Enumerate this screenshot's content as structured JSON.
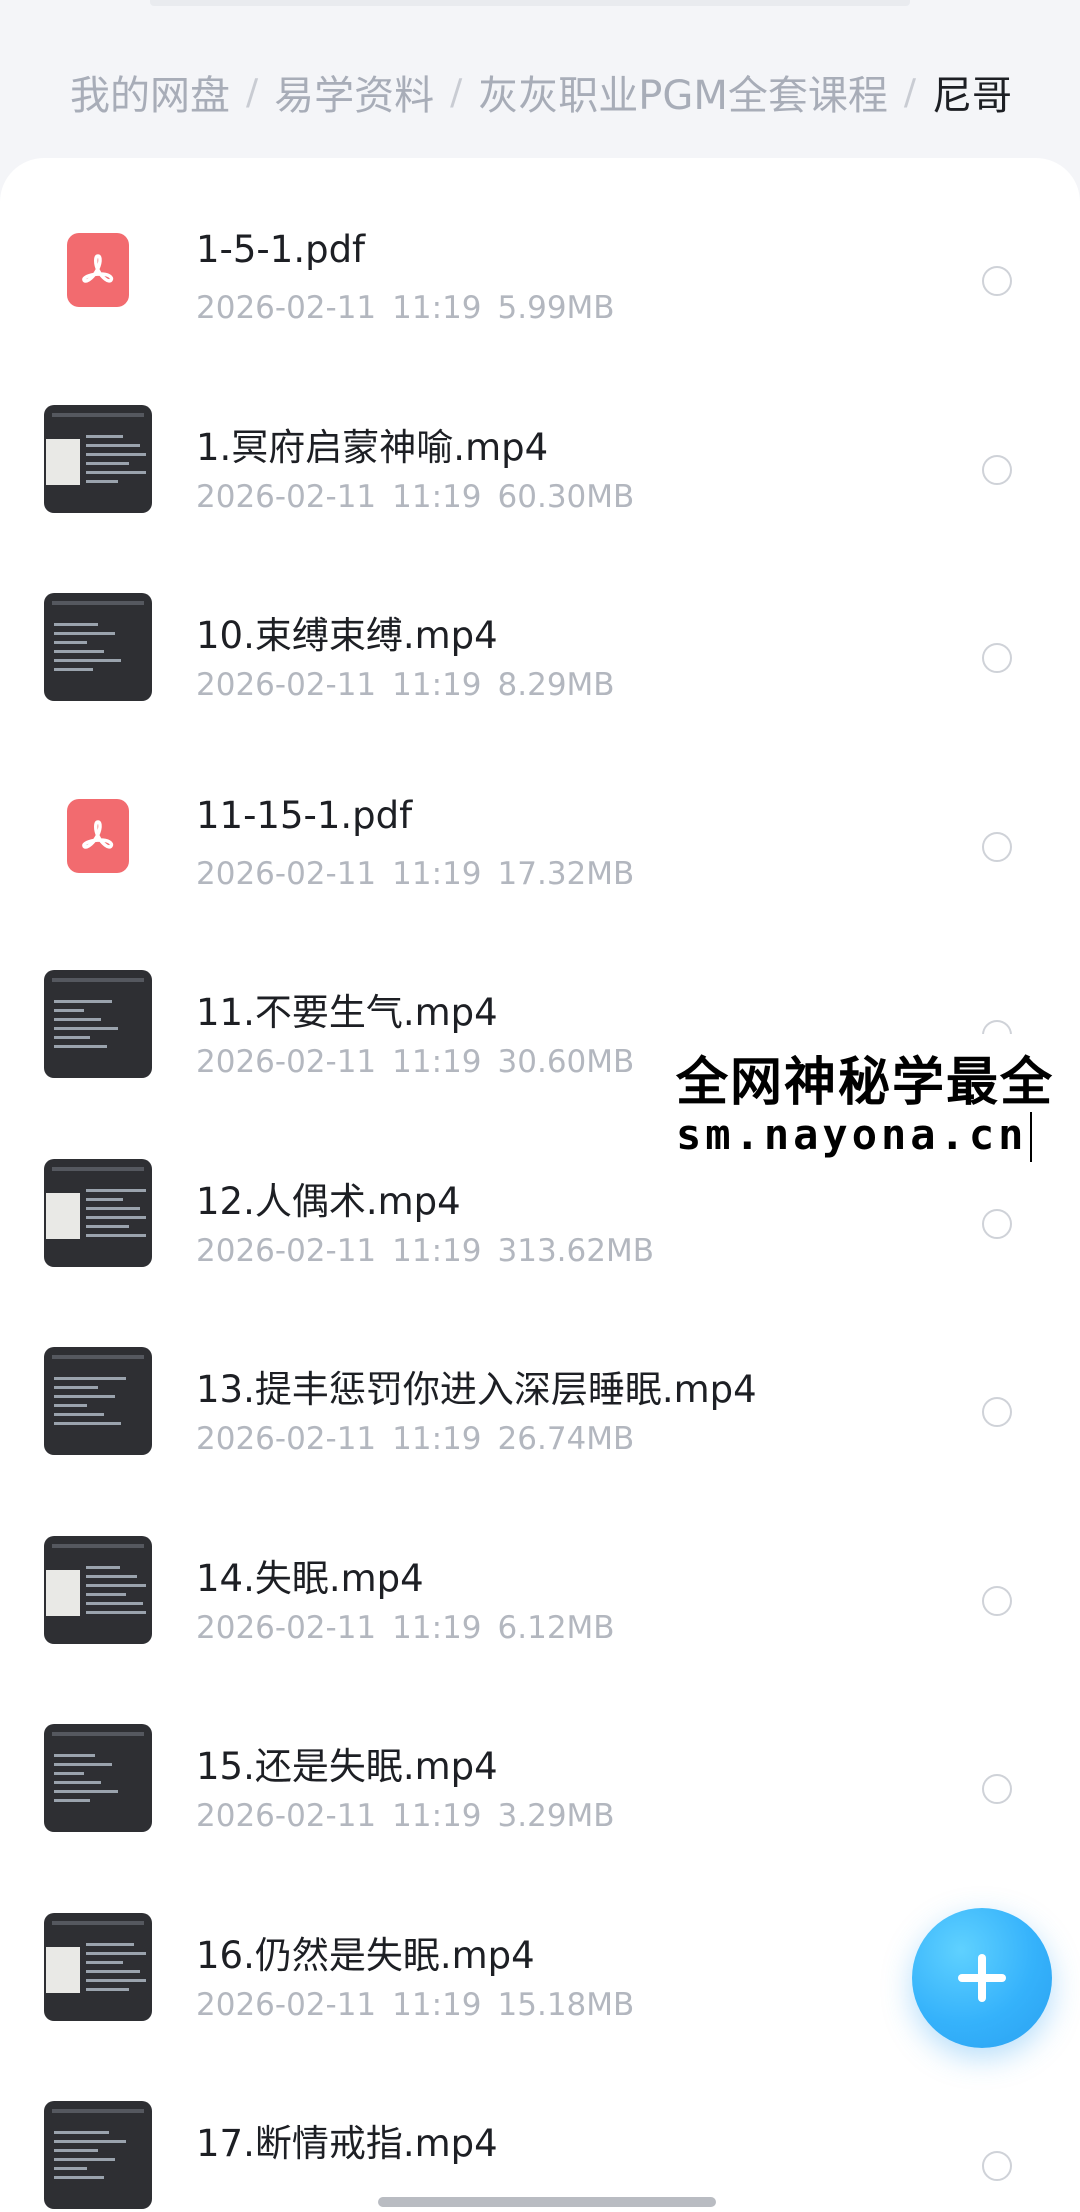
{
  "breadcrumb": {
    "items": [
      "我的网盘",
      "易学资料",
      "灰灰职业PGM全套课程"
    ],
    "current": "尼哥",
    "separator": "/"
  },
  "files": [
    {
      "name": "1-5-1.pdf",
      "date": "2026-02-11",
      "time": "11:19",
      "size": "5.99MB",
      "type": "pdf"
    },
    {
      "name": "1.冥府启蒙神喻.mp4",
      "date": "2026-02-11",
      "time": "11:19",
      "size": "60.30MB",
      "type": "video"
    },
    {
      "name": "10.束缚束缚.mp4",
      "date": "2026-02-11",
      "time": "11:19",
      "size": "8.29MB",
      "type": "video"
    },
    {
      "name": "11-15-1.pdf",
      "date": "2026-02-11",
      "time": "11:19",
      "size": "17.32MB",
      "type": "pdf"
    },
    {
      "name": "11.不要生气.mp4",
      "date": "2026-02-11",
      "time": "11:19",
      "size": "30.60MB",
      "type": "video"
    },
    {
      "name": "12.人偶术.mp4",
      "date": "2026-02-11",
      "time": "11:19",
      "size": "313.62MB",
      "type": "video"
    },
    {
      "name": "13.提丰惩罚你进入深层睡眠.mp4",
      "date": "2026-02-11",
      "time": "11:19",
      "size": "26.74MB",
      "type": "video"
    },
    {
      "name": "14.失眠.mp4",
      "date": "2026-02-11",
      "time": "11:19",
      "size": "6.12MB",
      "type": "video"
    },
    {
      "name": "15.还是失眠.mp4",
      "date": "2026-02-11",
      "time": "11:19",
      "size": "3.29MB",
      "type": "video"
    },
    {
      "name": "16.仍然是失眠.mp4",
      "date": "2026-02-11",
      "time": "11:19",
      "size": "15.18MB",
      "type": "video"
    },
    {
      "name": "17.断情戒指.mp4",
      "date": "",
      "time": "",
      "size": "",
      "type": "video"
    }
  ],
  "watermark": {
    "line1": "全网神秘学最全",
    "line2": "sm.nayona.cn"
  },
  "fab": {
    "icon": "plus-icon",
    "color": "#35b2fb"
  },
  "colors": {
    "pdf": "#f26b6f",
    "accent": "#35b2fb"
  }
}
